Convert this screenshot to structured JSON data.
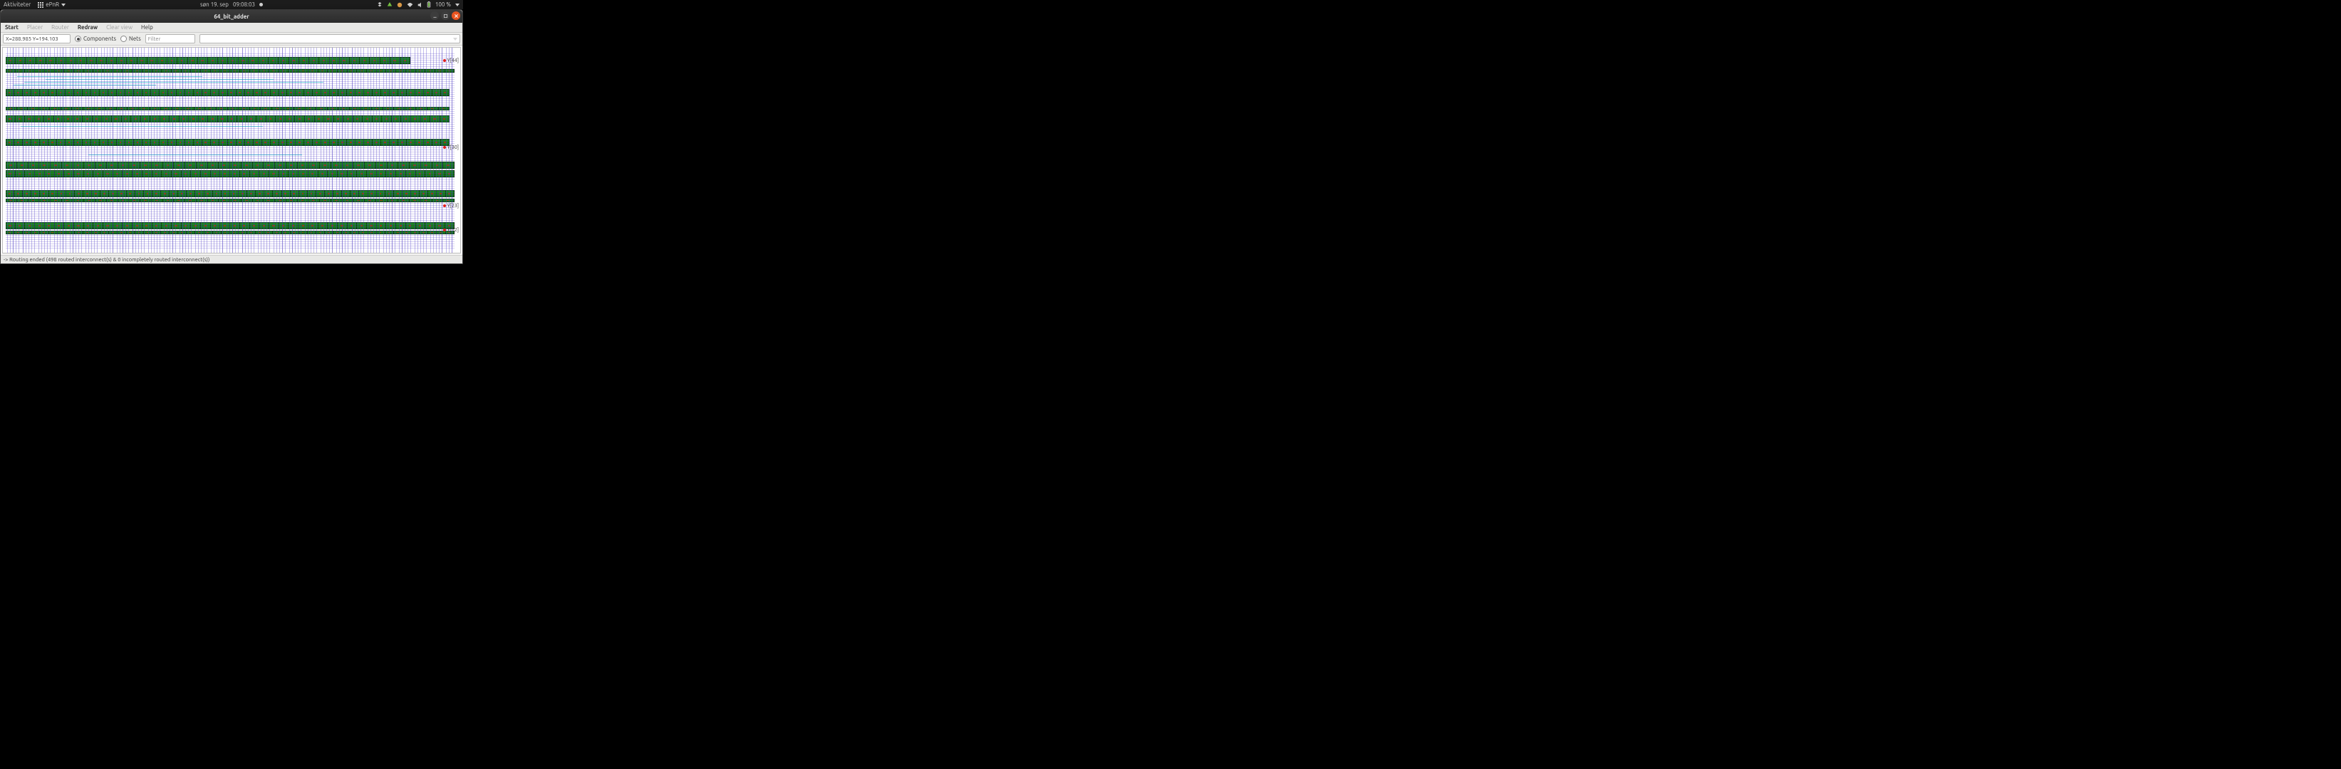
{
  "gnome": {
    "activities": "Aktiviteter",
    "app_name": "ePnR",
    "date": "søn 19. sep",
    "time": "09:08:03",
    "battery": "100 %"
  },
  "window": {
    "title": "64_bit_adder"
  },
  "menu": {
    "start": "Start",
    "placer": "Placer",
    "router": "Router",
    "redraw": "Redraw",
    "clearview": "Clear view",
    "help": "Help"
  },
  "toolbar": {
    "coords": "X=288.985 Y=194.103",
    "components": "Components",
    "nets": "Nets",
    "filter_placeholder": "Filter"
  },
  "pins": {
    "y44": "Y[44]",
    "y30": "Y[30]",
    "y23": "Y[23]",
    "y12": "Y[12]"
  },
  "status": {
    "text": "-> Routing ended (498 routed interconnect(s) & 0 incompletely routed interconnect(s))"
  }
}
